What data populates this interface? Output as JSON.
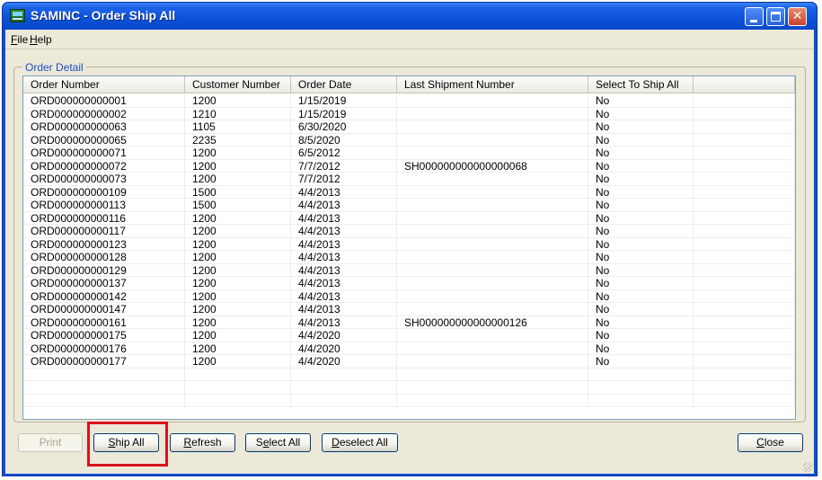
{
  "window": {
    "title": "SAMINC - Order Ship All"
  },
  "menu": {
    "file": {
      "accel": "F",
      "rest": "ile"
    },
    "help": {
      "accel": "H",
      "rest": "elp"
    }
  },
  "group": {
    "label": "Order Detail"
  },
  "table": {
    "columns": [
      "Order Number",
      "Customer Number",
      "Order Date",
      "Last Shipment Number",
      "Select To Ship All"
    ],
    "rows": [
      [
        "ORD000000000001",
        "1200",
        "1/15/2019",
        "",
        "No"
      ],
      [
        "ORD000000000002",
        "1210",
        "1/15/2019",
        "",
        "No"
      ],
      [
        "ORD000000000063",
        "1105",
        "6/30/2020",
        "",
        "No"
      ],
      [
        "ORD000000000065",
        "2235",
        "8/5/2020",
        "",
        "No"
      ],
      [
        "ORD000000000071",
        "1200",
        "6/5/2012",
        "",
        "No"
      ],
      [
        "ORD000000000072",
        "1200",
        "7/7/2012",
        "SH000000000000000068",
        "No"
      ],
      [
        "ORD000000000073",
        "1200",
        "7/7/2012",
        "",
        "No"
      ],
      [
        "ORD000000000109",
        "1500",
        "4/4/2013",
        "",
        "No"
      ],
      [
        "ORD000000000113",
        "1500",
        "4/4/2013",
        "",
        "No"
      ],
      [
        "ORD000000000116",
        "1200",
        "4/4/2013",
        "",
        "No"
      ],
      [
        "ORD000000000117",
        "1200",
        "4/4/2013",
        "",
        "No"
      ],
      [
        "ORD000000000123",
        "1200",
        "4/4/2013",
        "",
        "No"
      ],
      [
        "ORD000000000128",
        "1200",
        "4/4/2013",
        "",
        "No"
      ],
      [
        "ORD000000000129",
        "1200",
        "4/4/2013",
        "",
        "No"
      ],
      [
        "ORD000000000137",
        "1200",
        "4/4/2013",
        "",
        "No"
      ],
      [
        "ORD000000000142",
        "1200",
        "4/4/2013",
        "",
        "No"
      ],
      [
        "ORD000000000147",
        "1200",
        "4/4/2013",
        "",
        "No"
      ],
      [
        "ORD000000000161",
        "1200",
        "4/4/2013",
        "SH000000000000000126",
        "No"
      ],
      [
        "ORD000000000175",
        "1200",
        "4/4/2020",
        "",
        "No"
      ],
      [
        "ORD000000000176",
        "1200",
        "4/4/2020",
        "",
        "No"
      ],
      [
        "ORD000000000177",
        "1200",
        "4/4/2020",
        "",
        "No"
      ]
    ],
    "empty_rows": 3
  },
  "buttons": {
    "print": "Print",
    "ship_all": {
      "pre": "",
      "accel": "S",
      "post": "hip All"
    },
    "refresh": {
      "pre": "",
      "accel": "R",
      "post": "efresh"
    },
    "select_all": {
      "pre": "S",
      "accel": "e",
      "post": "lect All"
    },
    "deselect_all": {
      "pre": "",
      "accel": "D",
      "post": "eselect All"
    },
    "close": {
      "pre": "",
      "accel": "C",
      "post": "lose"
    }
  },
  "colors": {
    "highlight": "#d6141c",
    "titlebar": "#0a51d9"
  }
}
